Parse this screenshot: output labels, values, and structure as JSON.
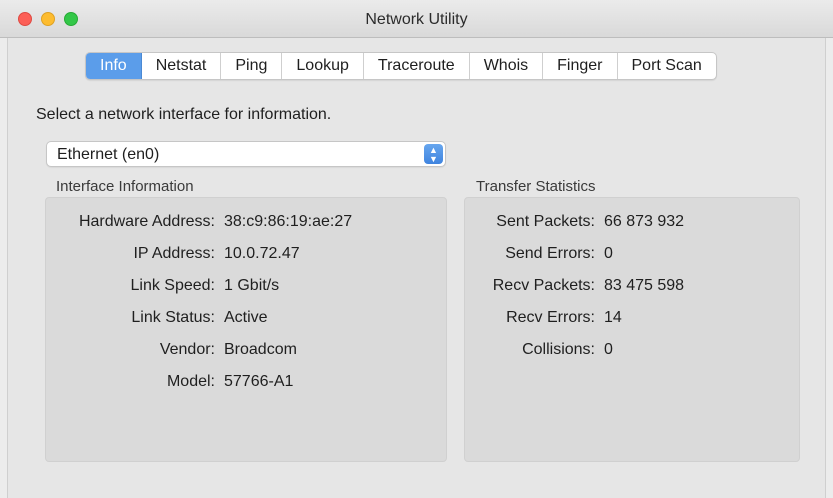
{
  "window": {
    "title": "Network Utility"
  },
  "tabs": [
    {
      "label": "Info",
      "active": true
    },
    {
      "label": "Netstat",
      "active": false
    },
    {
      "label": "Ping",
      "active": false
    },
    {
      "label": "Lookup",
      "active": false
    },
    {
      "label": "Traceroute",
      "active": false
    },
    {
      "label": "Whois",
      "active": false
    },
    {
      "label": "Finger",
      "active": false
    },
    {
      "label": "Port Scan",
      "active": false
    }
  ],
  "info": {
    "prompt": "Select a network interface for information.",
    "interface_select": "Ethernet (en0)",
    "interface_section": {
      "title": "Interface Information",
      "rows": [
        {
          "label": "Hardware Address:",
          "value": "38:c9:86:19:ae:27"
        },
        {
          "label": "IP Address:",
          "value": "10.0.72.47"
        },
        {
          "label": "Link Speed:",
          "value": "1 Gbit/s"
        },
        {
          "label": "Link Status:",
          "value": "Active"
        },
        {
          "label": "Vendor:",
          "value": "Broadcom"
        },
        {
          "label": "Model:",
          "value": "57766-A1"
        }
      ]
    },
    "transfer_section": {
      "title": "Transfer Statistics",
      "rows": [
        {
          "label": "Sent Packets:",
          "value": "66 873 932"
        },
        {
          "label": "Send Errors:",
          "value": "0"
        },
        {
          "label": "Recv Packets:",
          "value": "83 475 598"
        },
        {
          "label": "Recv Errors:",
          "value": "14"
        },
        {
          "label": "Collisions:",
          "value": "0"
        }
      ]
    }
  },
  "colors": {
    "accent": "#5b9dea",
    "close": "#fc5f57",
    "minimize": "#fdbc2f",
    "maximize": "#33c748"
  }
}
